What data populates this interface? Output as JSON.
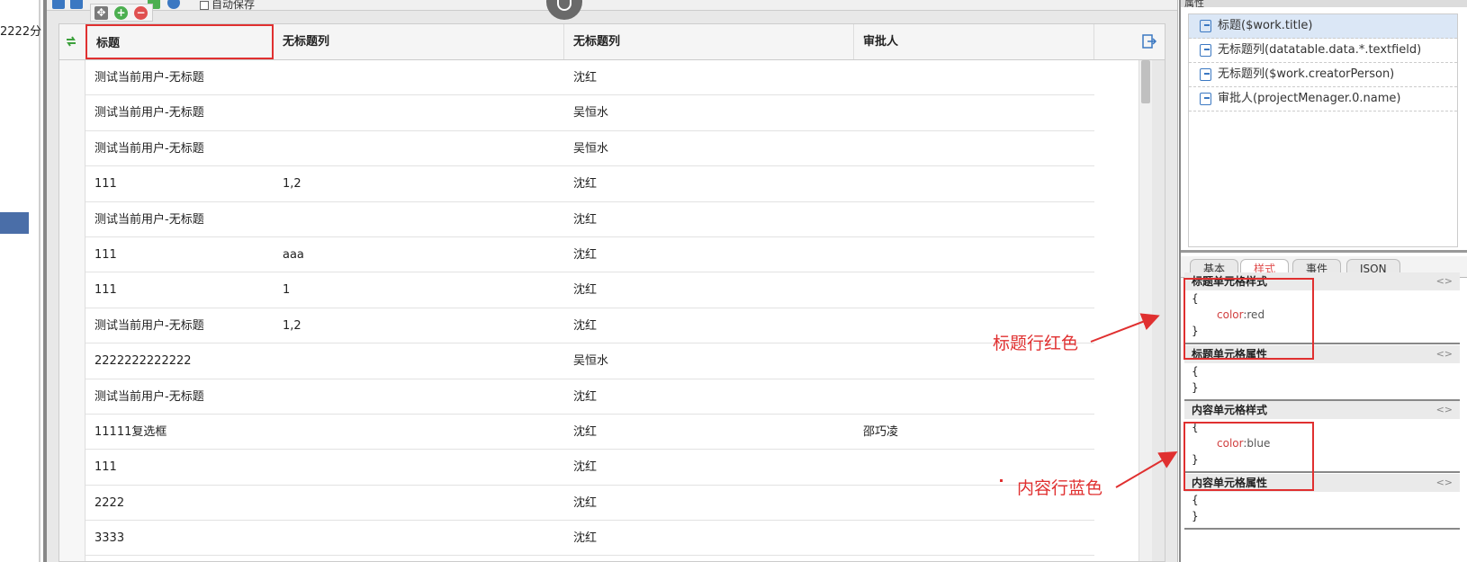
{
  "left_panel": {
    "text": "2222分"
  },
  "toolbar": {
    "autosave_label": "自动保存"
  },
  "grid": {
    "columns": [
      "标题",
      "无标题列",
      "无标题列",
      "审批人"
    ],
    "rows": [
      [
        "测试当前用户-无标题",
        "",
        "沈红",
        ""
      ],
      [
        "测试当前用户-无标题",
        "",
        "吴恒水",
        ""
      ],
      [
        "测试当前用户-无标题",
        "",
        "吴恒水",
        ""
      ],
      [
        "111",
        "1,2",
        "沈红",
        ""
      ],
      [
        "测试当前用户-无标题",
        "",
        "沈红",
        ""
      ],
      [
        "111",
        "aaa",
        "沈红",
        ""
      ],
      [
        "111",
        "1",
        "沈红",
        ""
      ],
      [
        "测试当前用户-无标题",
        "1,2",
        "沈红",
        ""
      ],
      [
        "2222222222222",
        "",
        "吴恒水",
        ""
      ],
      [
        "测试当前用户-无标题",
        "",
        "沈红",
        ""
      ],
      [
        "11111复选框",
        "",
        "沈红",
        "邵巧凌"
      ],
      [
        "111",
        "",
        "沈红",
        ""
      ],
      [
        "2222",
        "",
        "沈红",
        ""
      ],
      [
        "3333",
        "",
        "沈红",
        ""
      ]
    ]
  },
  "right_panel": {
    "title": "属性",
    "fields": [
      "标题($work.title)",
      "无标题列(datatable.data.*.textfield)",
      "无标题列($work.creatorPerson)",
      "审批人(projectMenager.0.name)"
    ],
    "tabs": [
      "基本",
      "样式",
      "事件",
      "JSON"
    ],
    "sections": [
      {
        "title": "标题单元格样式",
        "open": "{",
        "prop": "color",
        "sep": ":",
        "value": "red",
        "close": "}"
      },
      {
        "title": "标题单元格属性",
        "open": "{",
        "close": "}"
      },
      {
        "title": "内容单元格样式",
        "open": "{",
        "prop": "color",
        "sep": ":",
        "value": "blue",
        "close": "}"
      },
      {
        "title": "内容单元格属性",
        "open": "{",
        "close": "}"
      }
    ],
    "code_icon": "<>"
  },
  "annotations": {
    "header_red": "标题行红色",
    "content_blue": "内容行蓝色"
  },
  "colors": {
    "annotation": "#e03030",
    "selected_field": "#dbe7f6",
    "left_bar": "#4a6ea8"
  }
}
